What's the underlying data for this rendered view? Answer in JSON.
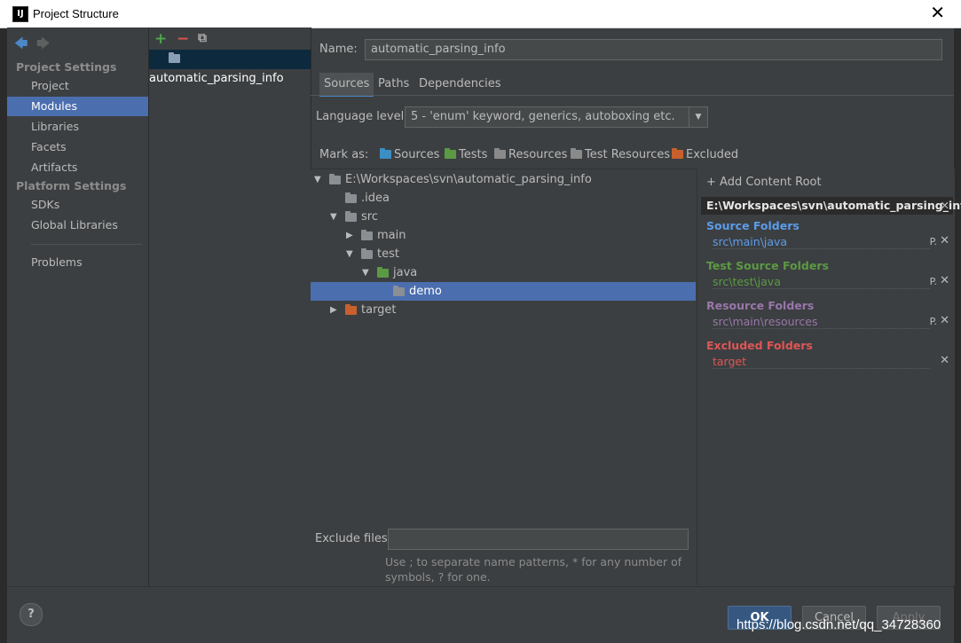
{
  "window": {
    "title": "Project Structure",
    "app_icon": "IJ"
  },
  "nav": {
    "project_settings_heading": "Project Settings",
    "project_items": [
      {
        "label": "Project",
        "selected": false
      },
      {
        "label": "Modules",
        "selected": true
      },
      {
        "label": "Libraries",
        "selected": false
      },
      {
        "label": "Facets",
        "selected": false
      },
      {
        "label": "Artifacts",
        "selected": false
      }
    ],
    "platform_settings_heading": "Platform Settings",
    "platform_items": [
      {
        "label": "SDKs"
      },
      {
        "label": "Global Libraries"
      }
    ],
    "problems": "Problems"
  },
  "modules": {
    "add": "+",
    "remove": "−",
    "items": [
      "automatic_parsing_info"
    ]
  },
  "module": {
    "name_label": "Name:",
    "name_value": "automatic_parsing_info",
    "tabs": [
      "Sources",
      "Paths",
      "Dependencies"
    ],
    "language_label": "Language level:",
    "language_value": "5 - 'enum' keyword, generics, autoboxing etc.",
    "mark_as_label": "Mark as:",
    "mark_as": [
      {
        "label": "Sources",
        "color": "#3d8ec4"
      },
      {
        "label": "Tests",
        "color": "#5b9a43"
      },
      {
        "label": "Resources",
        "color": "#8a8a8a"
      },
      {
        "label": "Test Resources",
        "color": "#8a8a8a"
      },
      {
        "label": "Excluded",
        "color": "#c8602e"
      }
    ]
  },
  "tree": [
    {
      "label": "E:\\Workspaces\\svn\\automatic_parsing_info",
      "depth": 0,
      "arrow": "down",
      "color": "#8a8f94",
      "selected": false
    },
    {
      "label": ".idea",
      "depth": 1,
      "arrow": "none",
      "color": "#8a8f94",
      "selected": false
    },
    {
      "label": "src",
      "depth": 1,
      "arrow": "down",
      "color": "#8a8f94",
      "selected": false
    },
    {
      "label": "main",
      "depth": 2,
      "arrow": "right",
      "color": "#8a8f94",
      "selected": false
    },
    {
      "label": "test",
      "depth": 2,
      "arrow": "down",
      "color": "#8a8f94",
      "selected": false
    },
    {
      "label": "java",
      "depth": 3,
      "arrow": "down",
      "color": "#5b9a43",
      "selected": false
    },
    {
      "label": "demo",
      "depth": 4,
      "arrow": "none",
      "color": "#8a8f94",
      "selected": true
    },
    {
      "label": "target",
      "depth": 1,
      "arrow": "right",
      "color": "#c8602e",
      "selected": false
    }
  ],
  "roots": {
    "add_label": "+ Add Content Root",
    "root_path": "E:\\Workspaces\\svn\\automatic_parsing_info",
    "sections": [
      {
        "title": "Source Folders",
        "title_color": "#5d9ce9",
        "path": "src\\main\\java",
        "path_color": "#5d9ce9",
        "has_props": true
      },
      {
        "title": "Test Source Folders",
        "title_color": "#5b9a43",
        "path": "src\\test\\java",
        "path_color": "#5b9a43",
        "has_props": true
      },
      {
        "title": "Resource Folders",
        "title_color": "#9876aa",
        "path": "src\\main\\resources",
        "path_color": "#9876aa",
        "has_props": true
      },
      {
        "title": "Excluded Folders",
        "title_color": "#e05555",
        "path": "target",
        "path_color": "#e05555",
        "has_props": false
      }
    ]
  },
  "exclude": {
    "label": "Exclude files:",
    "value": "",
    "hint_line1": "Use ; to separate name patterns, * for any number of",
    "hint_line2": "symbols, ? for one."
  },
  "buttons": {
    "ok": "OK",
    "cancel": "Cancel",
    "apply": "Apply",
    "help": "?"
  },
  "watermark": "https://blog.csdn.net/qq_34728360"
}
